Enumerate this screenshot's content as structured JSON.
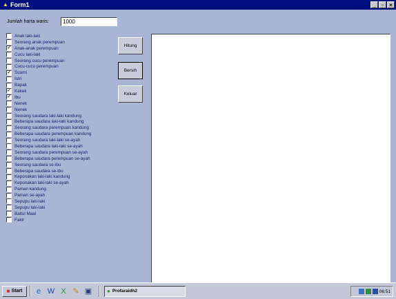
{
  "window": {
    "title": "Form1",
    "min_label": "_",
    "max_label": "▫",
    "close_label": "×"
  },
  "form": {
    "weight_label": "Jumlah harta waris:",
    "weight_value": "1000",
    "heirs": [
      {
        "label": "Anak laki-laki",
        "checked": false
      },
      {
        "label": "Seorang anak perempuan",
        "checked": false
      },
      {
        "label": "Anak-anak perempuan",
        "checked": true
      },
      {
        "label": "Cucu laki-laki",
        "checked": false
      },
      {
        "label": "Seorang cucu perempuan",
        "checked": false
      },
      {
        "label": "Cucu-cucu perempuan",
        "checked": false
      },
      {
        "label": "Suami",
        "checked": true
      },
      {
        "label": "Istri",
        "checked": false
      },
      {
        "label": "Bapak",
        "checked": false
      },
      {
        "label": "Kakek",
        "checked": true
      },
      {
        "label": "Ibu",
        "checked": true
      },
      {
        "label": "Nenek",
        "checked": false
      },
      {
        "label": "Nenek",
        "checked": false
      },
      {
        "label": "Seorang saudara laki-laki kandung",
        "checked": false
      },
      {
        "label": "Beberapa saudara laki-laki kandung",
        "checked": false
      },
      {
        "label": "Seorang saudara perempuan kandung",
        "checked": false
      },
      {
        "label": "Beberapa saudara perempuan kandung",
        "checked": false
      },
      {
        "label": "Seorang saudara laki-laki se-ayah",
        "checked": false
      },
      {
        "label": "Beberapa saudara laki-laki se-ayah",
        "checked": false
      },
      {
        "label": "Seorang saudara perempuan se-ayah",
        "checked": false
      },
      {
        "label": "Beberapa saudara perempuan se-ayah",
        "checked": false
      },
      {
        "label": "Seorang saudara se-ibu",
        "checked": false
      },
      {
        "label": "Beberapa saudara se-ibu",
        "checked": false
      },
      {
        "label": "Keponakan laki-laki kandung",
        "checked": false
      },
      {
        "label": "Keponakan laki-laki se-ayah",
        "checked": false
      },
      {
        "label": "Paman kandung",
        "checked": false
      },
      {
        "label": "Paman se-ayah",
        "checked": false
      },
      {
        "label": "Sepupu laki-laki",
        "checked": false
      },
      {
        "label": "Sepupu laki-laki",
        "checked": false
      },
      {
        "label": "Baitul Maal",
        "checked": false
      },
      {
        "label": "Fakir",
        "checked": false
      }
    ],
    "buttons": {
      "hitung": "Hitung",
      "bersih": "Bersih",
      "keluar": "Keluar"
    }
  },
  "taskbar": {
    "start_label": "Start",
    "task_label": "Profaraidh2",
    "clock": "06:51",
    "quick_launch_icons": [
      "ie-icon",
      "word-icon",
      "excel-icon",
      "paint-icon",
      "desktop-icon"
    ]
  },
  "colors": {
    "titlebar": "#000f7e",
    "form_bg": "#a8b5d4",
    "label_text": "#16206a"
  }
}
